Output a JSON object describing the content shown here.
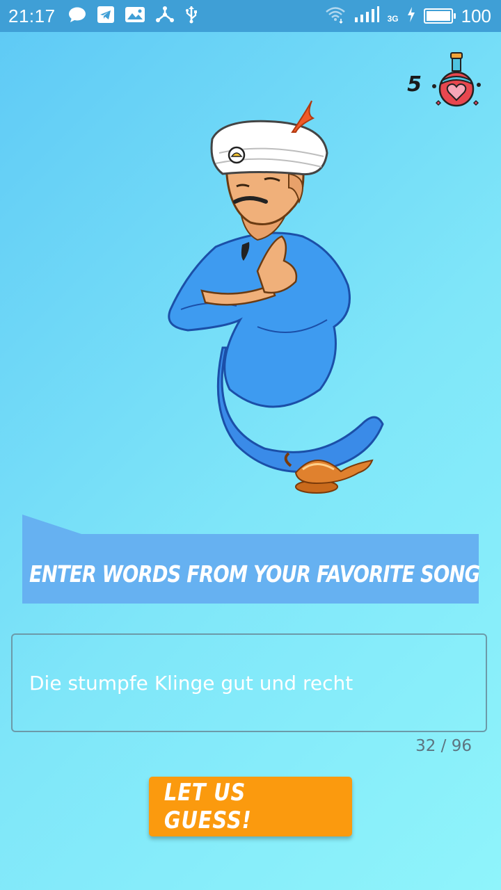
{
  "status_bar": {
    "time": "21:17",
    "network": "3G",
    "battery": "100",
    "battery_level": 1.0,
    "icons_left": [
      "chat-bubble-icon",
      "telegram-icon",
      "image-message-icon",
      "share-icon",
      "usb-icon"
    ],
    "icons_right": [
      "wifi-icon",
      "signal-icon",
      "charging-icon",
      "battery-icon"
    ]
  },
  "lives": {
    "count": "5",
    "icon": "potion-heart-icon"
  },
  "banner": {
    "text": "ENTER WORDS FROM YOUR FAVORITE SONG",
    "color": "#66b1f1"
  },
  "song_input": {
    "value": "Die stumpfe Klinge gut und recht",
    "counter": "32 / 96"
  },
  "guess_button": {
    "label": "LET US GUESS!",
    "color": "#fb9a0e"
  }
}
